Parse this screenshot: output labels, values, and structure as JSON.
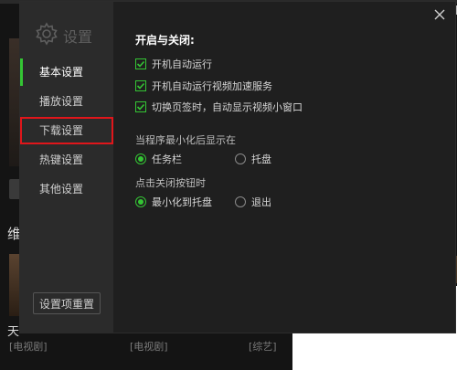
{
  "background": {
    "section_title": "维",
    "item_title": "天",
    "tags": [
      "[电视剧]",
      "[电视剧]",
      "[综艺]"
    ]
  },
  "dialog": {
    "logo_label": "设置",
    "icons": {
      "logo": "gear-icon",
      "close": "close-icon"
    },
    "nav": [
      {
        "label": "基本设置",
        "active": true
      },
      {
        "label": "播放设置",
        "active": false
      },
      {
        "label": "下载设置",
        "active": false,
        "highlighted": true
      },
      {
        "label": "热键设置",
        "active": false
      },
      {
        "label": "其他设置",
        "active": false
      }
    ],
    "reset_label": "设置项重置",
    "heading": "开启与关闭:",
    "checkboxes": [
      {
        "label": "开机自动运行",
        "checked": true
      },
      {
        "label": "开机自动运行视频加速服务",
        "checked": true
      },
      {
        "label": "切换页签时，自动显示视频小窗口",
        "checked": true
      }
    ],
    "minimize_group": {
      "label": "当程序最小化后显示在",
      "options": [
        {
          "label": "任务栏",
          "selected": true
        },
        {
          "label": "托盘",
          "selected": false
        }
      ]
    },
    "close_group": {
      "label": "点击关闭按钮时",
      "options": [
        {
          "label": "最小化到托盘",
          "selected": true
        },
        {
          "label": "退出",
          "selected": false
        }
      ]
    }
  },
  "colors": {
    "accent": "#34c534",
    "highlight_border": "#e0161b",
    "sidebar_bg": "#2b2b2b",
    "dialog_bg": "#1f1f1f"
  }
}
